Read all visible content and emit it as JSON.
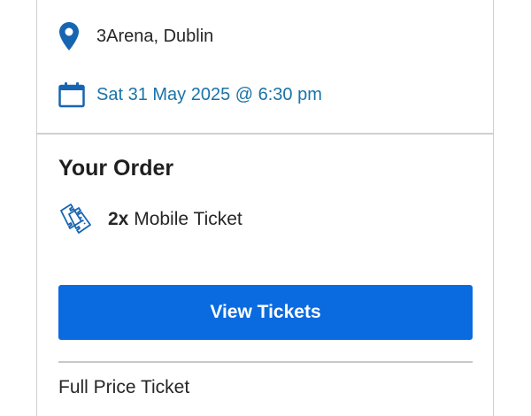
{
  "event": {
    "venue": "3Arena, Dublin",
    "date_time": "Sat 31 May 2025 @ 6:30 pm",
    "icons": {
      "venue": "location-pin-icon",
      "date": "calendar-icon"
    }
  },
  "order": {
    "title": "Your Order",
    "ticket_icon": "tickets-icon",
    "quantity": "2x",
    "ticket_type": "Mobile Ticket",
    "view_button_label": "View Tickets",
    "price_label": "Full Price Ticket"
  },
  "colors": {
    "accent": "#0a6ae0",
    "link": "#1a73a8",
    "icon": "#1665b0"
  }
}
